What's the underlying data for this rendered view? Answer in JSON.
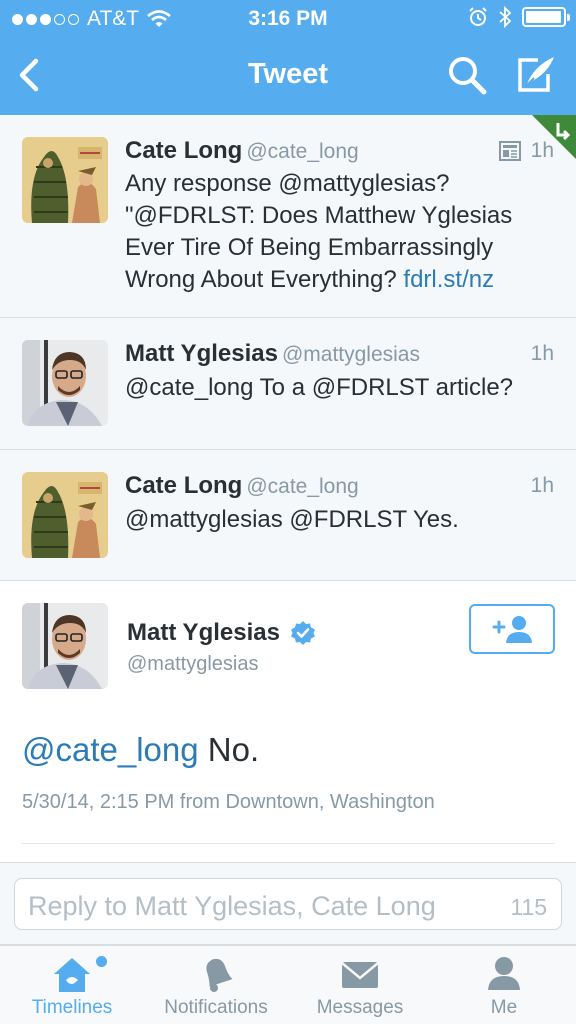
{
  "status_bar": {
    "carrier": "AT&T",
    "time": "3:16 PM",
    "icons": [
      "signal-dots",
      "wifi-icon",
      "alarm-icon",
      "bluetooth-icon",
      "battery-icon"
    ]
  },
  "nav": {
    "title": "Tweet",
    "icons": [
      "back-chevron-icon",
      "search-icon",
      "compose-icon"
    ]
  },
  "colors": {
    "brand": "#55acee",
    "link": "#2b7bb9",
    "verified": "#55acee",
    "muted": "#8899a6"
  },
  "tweets": [
    {
      "name": "Cate Long",
      "handle": "@cate_long",
      "time": "1h",
      "has_card_icon": true,
      "text": "Any response @mattyglesias? \"@FDRLST: Does Matthew Yglesias Ever Tire Of Being Embarrassingly Wrong About Everything?",
      "link": "fdrl.st/nz"
    },
    {
      "name": "Matt Yglesias",
      "handle": "@mattyglesias",
      "time": "1h",
      "text": "@cate_long To a @FDRLST article?"
    },
    {
      "name": "Cate Long",
      "handle": "@cate_long",
      "time": "1h",
      "text": "@mattyglesias @FDRLST Yes."
    }
  ],
  "detail": {
    "name": "Matt Yglesias",
    "handle": "@mattyglesias",
    "verified": true,
    "mention": "@cate_long",
    "body": "No.",
    "meta": "5/30/14, 2:15 PM from Downtown, Washington"
  },
  "reply": {
    "placeholder": "Reply to Matt Yglesias, Cate Long",
    "remaining": "115"
  },
  "tabs": [
    {
      "label": "Timelines",
      "icon": "home-icon",
      "active": true
    },
    {
      "label": "Notifications",
      "icon": "bell-icon",
      "active": false
    },
    {
      "label": "Messages",
      "icon": "envelope-icon",
      "active": false
    },
    {
      "label": "Me",
      "icon": "person-icon",
      "active": false
    }
  ]
}
